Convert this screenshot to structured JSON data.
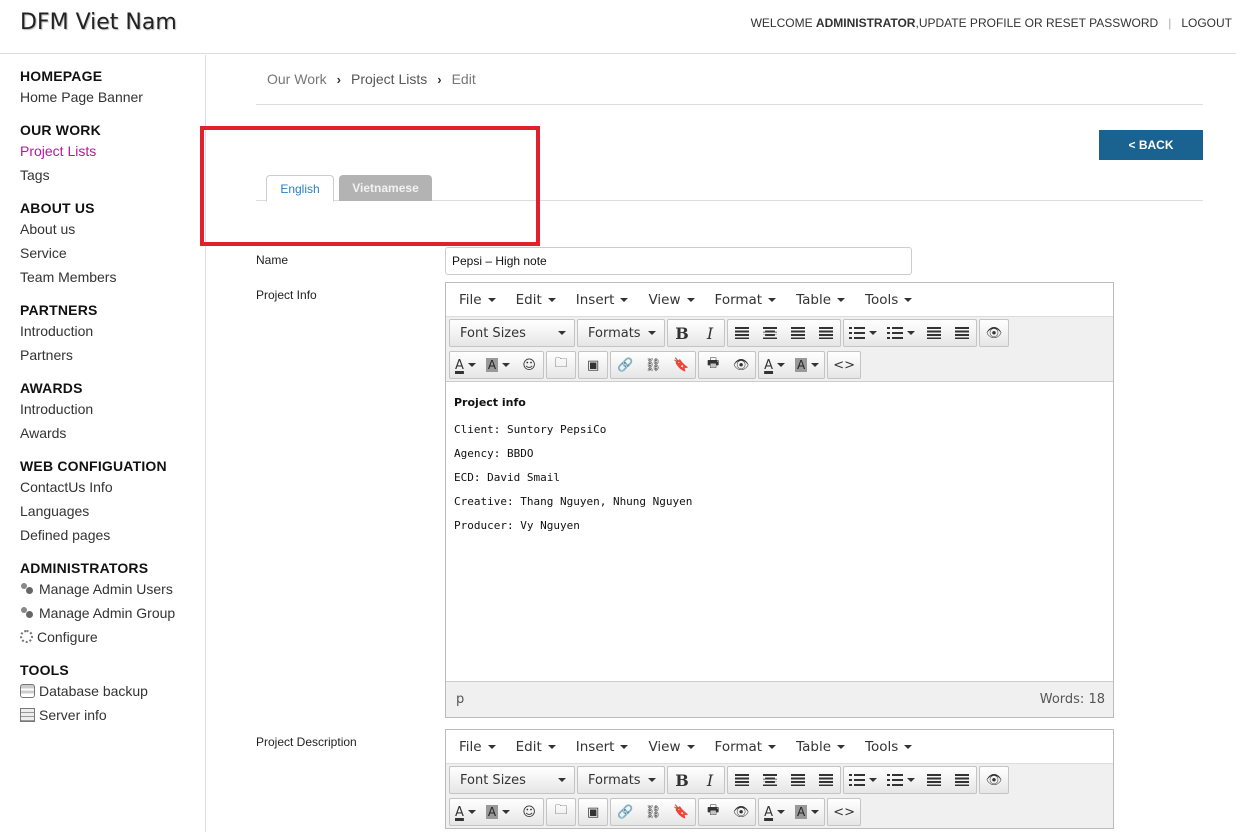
{
  "header": {
    "brand": "DFM Viet Nam",
    "welcome_prefix": "WELCOME ",
    "user": "ADMINISTRATOR",
    "update_profile_text": " ,UPDATE PROFILE OR RESET PASSWORD",
    "separator": "|",
    "logout": "LOGOUT"
  },
  "sidebar": {
    "sections": [
      {
        "title": "HOMEPAGE",
        "items": [
          "Home Page Banner"
        ]
      },
      {
        "title": "OUR WORK",
        "items": [
          "Project Lists",
          "Tags"
        ]
      },
      {
        "title": "ABOUT US",
        "items": [
          "About us",
          "Service",
          "Team Members"
        ]
      },
      {
        "title": "PARTNERS",
        "items": [
          "Introduction",
          "Partners"
        ]
      },
      {
        "title": "AWARDS",
        "items": [
          "Introduction",
          "Awards"
        ]
      },
      {
        "title": "WEB CONFIGUATION",
        "items": [
          "ContactUs Info",
          "Languages",
          "Defined pages"
        ]
      },
      {
        "title": "ADMINISTRATORS",
        "items": [
          "Manage Admin Users",
          "Manage Admin Group",
          "Configure"
        ]
      },
      {
        "title": "TOOLS",
        "items": [
          "Database backup",
          "Server info"
        ]
      }
    ],
    "active_item": "Project Lists",
    "icons": {
      "Manage Admin Users": "users-icon",
      "Manage Admin Group": "users-icon",
      "Configure": "gear-icon",
      "Database backup": "database-icon",
      "Server info": "server-icon"
    }
  },
  "breadcrumb": [
    "Our Work",
    "Project Lists",
    "Edit"
  ],
  "back_button": "< BACK",
  "tabs": [
    "English",
    "Vietnamese"
  ],
  "active_tab": "English",
  "form": {
    "name_label": "Name",
    "name_value": "Pepsi – High note",
    "project_info_label": "Project Info",
    "project_description_label": "Project Description"
  },
  "editor": {
    "menus": [
      "File",
      "Edit",
      "Insert",
      "View",
      "Format",
      "Table",
      "Tools"
    ],
    "font_sizes": "Font Sizes",
    "formats": "Formats",
    "bold": "B",
    "italic": "I",
    "text_color": "A",
    "bg_color": "A",
    "emoji": "☺",
    "source_code": "<>",
    "content_heading": "Project info",
    "content_lines": [
      "Client: Suntory PepsiCo",
      "Agency: BBDO",
      "ECD: David Smail",
      "Creative: Thang Nguyen, Nhung Nguyen",
      "Producer: Vy Nguyen"
    ],
    "path": "p",
    "word_count": "Words: 18"
  },
  "colors": {
    "back_button": "#1a6391",
    "active_nav": "#b5179e",
    "highlight_box": "#e0202a",
    "inactive_tab": "#b3b3b3"
  }
}
